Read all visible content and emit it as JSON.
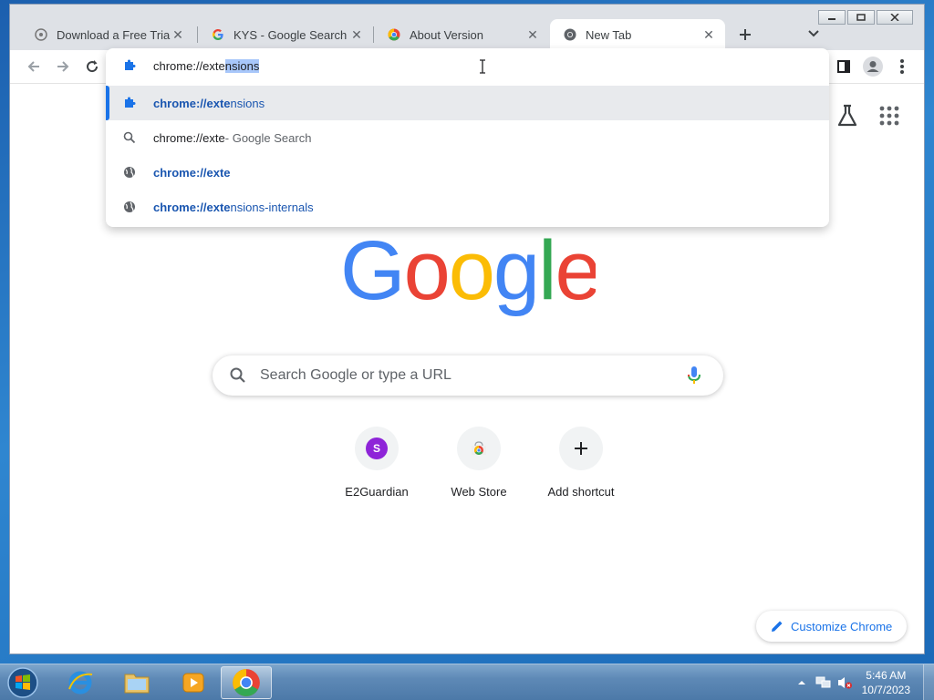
{
  "tabs": [
    {
      "title": "Download a Free Trial of",
      "favicon": "page-icon"
    },
    {
      "title": "KYS - Google Search",
      "favicon": "google-g-icon"
    },
    {
      "title": "About Version",
      "favicon": "chrome-icon"
    },
    {
      "title": "New Tab",
      "favicon": "chrome-icon",
      "active": true
    }
  ],
  "omnibox": {
    "typed": "chrome://exte",
    "autocomplete_selected": "nsions",
    "suggestions": [
      {
        "bold": "chrome://exte",
        "rest": "nsions",
        "desc": "",
        "icon": "extension-puzzle-icon",
        "highlighted": true
      },
      {
        "plain": "chrome://exte",
        "desc": " - Google Search",
        "icon": "search-icon"
      },
      {
        "bold": "chrome://exte",
        "rest": "",
        "desc": "",
        "icon": "globe-icon"
      },
      {
        "bold": "chrome://exte",
        "rest": "nsions-internals",
        "desc": "",
        "icon": "globe-icon"
      }
    ]
  },
  "newtab": {
    "search_placeholder": "Search Google or type a URL",
    "shortcuts": [
      {
        "label": "E2Guardian",
        "initial": "S"
      },
      {
        "label": "Web Store"
      },
      {
        "label": "Add shortcut"
      }
    ],
    "customize_label": "Customize Chrome"
  },
  "taskbar": {
    "time": "5:46 AM",
    "date": "10/7/2023"
  },
  "colors": {
    "accent": "#1a73e8",
    "google_blue": "#4285f4",
    "google_red": "#ea4335",
    "google_yellow": "#fbbc05",
    "google_green": "#34a853"
  }
}
